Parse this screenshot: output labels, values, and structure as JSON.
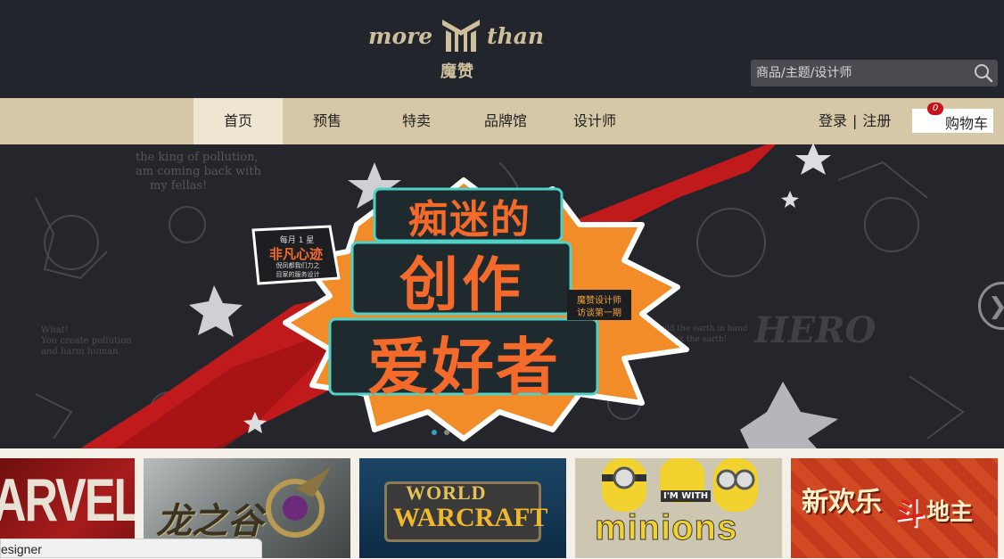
{
  "header": {
    "logo": {
      "word_left": "more",
      "word_right": "than",
      "chinese": "魔赞"
    },
    "search": {
      "placeholder": "商品/主题/设计师",
      "value": ""
    }
  },
  "nav": {
    "items": [
      {
        "label": "首页",
        "active": true
      },
      {
        "label": "预售",
        "active": false
      },
      {
        "label": "特卖",
        "active": false
      },
      {
        "label": "品牌馆",
        "active": false
      },
      {
        "label": "设计师",
        "active": false
      }
    ],
    "login": "登录",
    "separator": "|",
    "register": "注册",
    "cart": {
      "label": "购物车",
      "count": "0"
    }
  },
  "banner": {
    "headline_top": "痴迷的",
    "headline_middle": "创作",
    "headline_bottom": "爱好者",
    "side_tag_line1": "每月 1 星",
    "side_tag_line2": "非凡心迹",
    "side_tag_line3": "倪凤都我们力之",
    "side_tag_line4": "目家的服务设计",
    "right_tag_line1": "魔赞设计师",
    "right_tag_line2": "访谈第一期",
    "doodle_1": "the king of pollution,",
    "doodle_2": "am coming back with",
    "doodle_3": "my fellas!",
    "doodle_4": "What!",
    "doodle_5": "You create pollution",
    "doodle_6": "and harm human",
    "doodle_7": "I'll hold the earth in hand",
    "doodle_8": "to protect the earth!",
    "doodle_9": "HERO",
    "slide_count": 2,
    "active_slide": 1
  },
  "thumbnails": [
    {
      "name": "marvel",
      "title": "ARVEL",
      "bg": "#8e1414"
    },
    {
      "name": "dragon-valley",
      "title": "龙之谷",
      "bg": "#6a7070"
    },
    {
      "name": "world-of-warcraft",
      "title_top": "WORLD",
      "title": "WARCRAFT",
      "bg": "#0d2b45"
    },
    {
      "name": "minions",
      "title_top": "I'M WITH",
      "title": "minions",
      "bg": "#bfb9a4"
    },
    {
      "name": "doudizhu",
      "title": "新欢乐",
      "title_2": "斗",
      "title_3": "地主",
      "bg": "#c43a1c"
    }
  ],
  "tooltip": {
    "text": "esigner"
  },
  "colors": {
    "header_bg": "#23252c",
    "nav_bg": "#d6c8a6",
    "nav_active_bg": "#efe6d2",
    "logo_gold": "#cdbf9c",
    "badge_red": "#c8121b",
    "banner_red": "#d41a1a",
    "banner_orange": "#f28c28"
  }
}
